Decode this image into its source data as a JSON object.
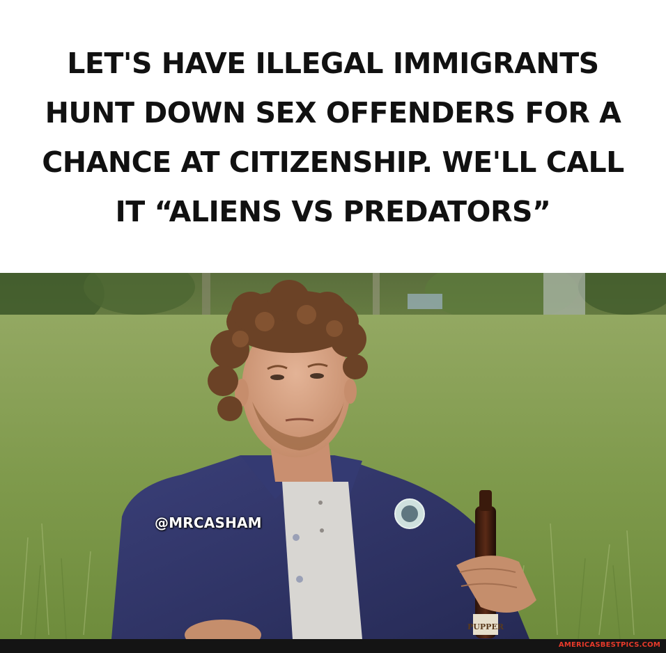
{
  "meme": {
    "caption_lines": [
      "LET'S HAVE ILLEGAL IMMIGRANTS",
      "HUNT DOWN SEX OFFENDERS FOR A",
      "CHANCE AT CITIZENSHIP. WE'LL CALL",
      "IT “ALIENS VS PREDATORS”"
    ],
    "handle": "@MRCASHAM",
    "watermark": "AMERICASBESTPICS.COM",
    "bottle_label": "PUPPER"
  },
  "colors": {
    "caption_text": "#111111",
    "grass": "#7f9a4c",
    "jacket": "#2e3366",
    "watermark": "#e83a2a",
    "footer_bg": "#141414"
  }
}
